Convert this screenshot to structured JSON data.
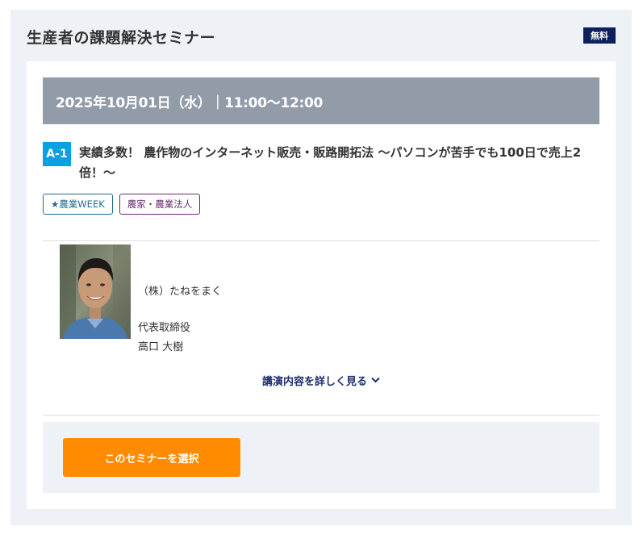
{
  "section": {
    "title": "生産者の課題解決セミナー",
    "free_badge": "無料"
  },
  "seminar": {
    "datetime": "2025年10月01日（水）｜11:00～12:00",
    "code": "A-1",
    "title": "実績多数！ 農作物のインターネット販売・販路開拓法 ～パソコンが苦手でも100日で売上2倍！～",
    "tags": [
      "★農業WEEK",
      "農家・農業法人"
    ],
    "speaker": {
      "company": "（株）たねをまく",
      "position": "代表取締役",
      "name": "高口 大樹"
    },
    "details_link": "講演内容を詳しく見る",
    "details_icon": "chevron-down-icon",
    "select_button": "このセミナーを選択"
  },
  "colors": {
    "date_bar": "#929ca9",
    "code_badge": "#0aa0e6",
    "free_badge": "#0d1f5c",
    "select_button": "#ff8c00",
    "link": "#1c2e6e"
  }
}
